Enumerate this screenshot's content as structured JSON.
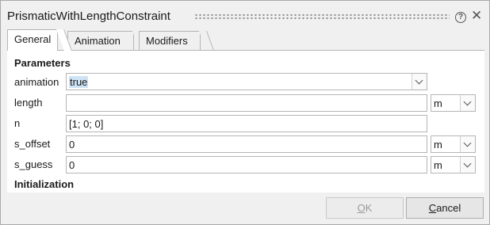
{
  "window": {
    "title": "PrismaticWithLengthConstraint"
  },
  "tabs": [
    {
      "label": "General",
      "active": true
    },
    {
      "label": "Animation",
      "active": false
    },
    {
      "label": "Modifiers",
      "active": false
    }
  ],
  "sections": {
    "parameters": "Parameters",
    "initialization": "Initialization"
  },
  "params": {
    "animation": {
      "label": "animation",
      "value": "true"
    },
    "length": {
      "label": "length",
      "value": "",
      "unit": "m"
    },
    "n": {
      "label": "n",
      "value": "[1; 0; 0]"
    },
    "s_offset": {
      "label": "s_offset",
      "value": "0",
      "unit": "m"
    },
    "s_guess": {
      "label": "s_guess",
      "value": "0",
      "unit": "m"
    }
  },
  "buttons": {
    "ok": {
      "label_hot": "O",
      "label_rest": "K",
      "enabled": false
    },
    "cancel": {
      "label_hot": "C",
      "label_rest": "ancel",
      "enabled": true
    }
  },
  "icons": {
    "help": "help-icon",
    "close": "close-icon"
  }
}
